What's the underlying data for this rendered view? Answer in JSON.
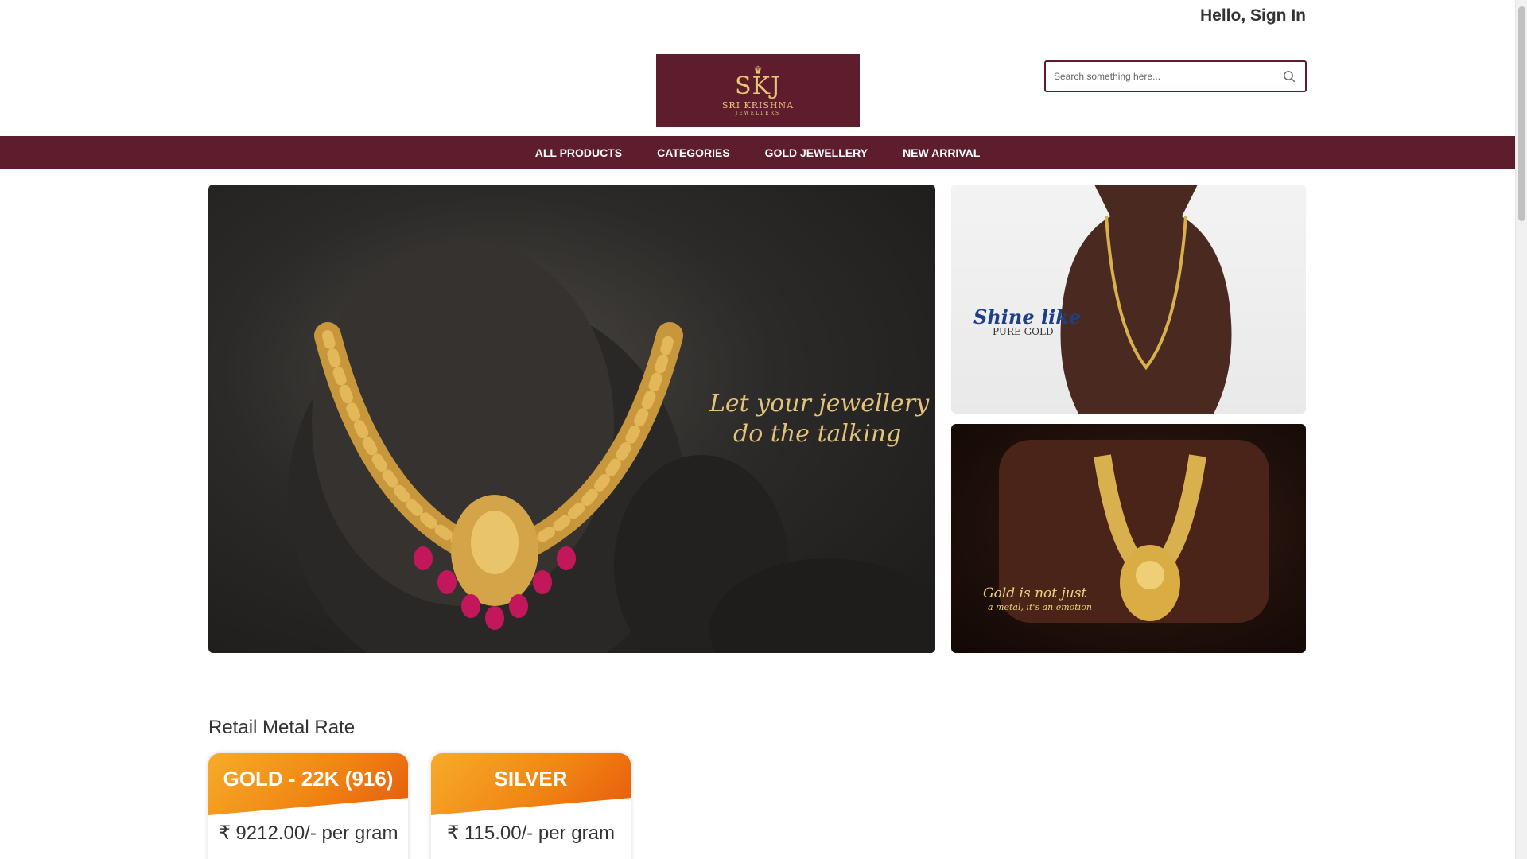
{
  "header": {
    "signin_label": "Hello, Sign In",
    "logo": {
      "mark": "SKJ",
      "name": "SRI KRISHNA",
      "sub": "JEWELLERS"
    }
  },
  "search": {
    "placeholder": "Search something here...",
    "value": ""
  },
  "nav": {
    "items": [
      {
        "label": "ALL PRODUCTS"
      },
      {
        "label": "CATEGORIES"
      },
      {
        "label": "GOLD JEWELLERY"
      },
      {
        "label": "NEW ARRIVAL"
      }
    ]
  },
  "banners": {
    "main": {
      "line1": "Let your jewellery",
      "line2": "do the talking"
    },
    "top": {
      "line1": "Shine like",
      "line2": "PURE GOLD"
    },
    "bottom": {
      "line1": "Gold is not just",
      "line2": "a metal, it's an emotion"
    }
  },
  "rates": {
    "title": "Retail Metal Rate",
    "cards": [
      {
        "metal": "GOLD - 22K (916)",
        "price": "₹ 9212.00/- per gram"
      },
      {
        "metal": "SILVER",
        "price": "₹ 115.00/- per gram"
      }
    ]
  },
  "colors": {
    "brand": "#5e1d2d",
    "gold_text": "#e8c777",
    "card_orange": "#f08613"
  }
}
